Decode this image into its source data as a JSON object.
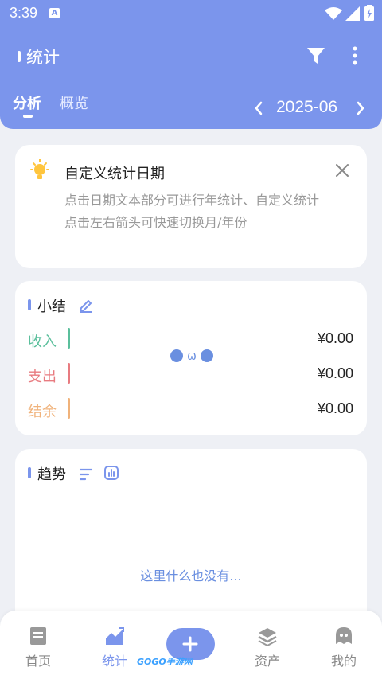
{
  "status": {
    "time": "3:39",
    "sim_badge": "A"
  },
  "header": {
    "title": "统计",
    "tabs": [
      {
        "label": "分析"
      },
      {
        "label": "概览"
      }
    ],
    "date": "2025-06"
  },
  "tip": {
    "title": "自定义统计日期",
    "body": "点击日期文本部分可进行年统计、自定义统计\n点击左右箭头可快速切换月/年份"
  },
  "summary": {
    "title": "小结",
    "rows": [
      {
        "label": "收入",
        "value": "¥0.00",
        "color": "#5bbf9c"
      },
      {
        "label": "支出",
        "value": "¥0.00",
        "color": "#e87b80"
      },
      {
        "label": "结余",
        "value": "¥0.00",
        "color": "#f0b27a"
      }
    ],
    "placeholder_face": "●ω●"
  },
  "trend": {
    "title": "趋势",
    "empty_text": "这里什么也没有..."
  },
  "bottom_nav": [
    {
      "label": "首页",
      "icon": "home-doc-icon"
    },
    {
      "label": "统计",
      "icon": "chart-icon"
    },
    {
      "label": "",
      "icon": "plus-icon"
    },
    {
      "label": "资产",
      "icon": "layers-icon"
    },
    {
      "label": "我的",
      "icon": "ghost-icon"
    }
  ],
  "watermark": "GOGO手游网",
  "colors": {
    "accent": "#7b95ec",
    "background": "#eef0f5"
  }
}
